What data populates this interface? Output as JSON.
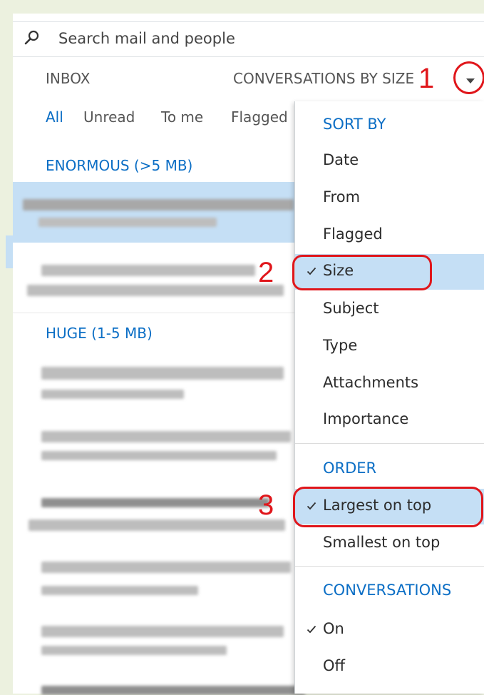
{
  "search": {
    "placeholder": "Search mail and people"
  },
  "header": {
    "inbox_title": "INBOX",
    "view_label": "CONVERSATIONS BY SIZE"
  },
  "filters": [
    "All",
    "Unread",
    "To me",
    "Flagged"
  ],
  "groups": [
    {
      "label": "ENORMOUS (>5 MB)"
    },
    {
      "label": "HUGE (1-5 MB)"
    }
  ],
  "menu": {
    "sort_heading": "SORT BY",
    "sort_items": [
      {
        "label": "Date",
        "checked": false
      },
      {
        "label": "From",
        "checked": false
      },
      {
        "label": "Flagged",
        "checked": false
      },
      {
        "label": "Size",
        "checked": true
      },
      {
        "label": "Subject",
        "checked": false
      },
      {
        "label": "Type",
        "checked": false
      },
      {
        "label": "Attachments",
        "checked": false
      },
      {
        "label": "Importance",
        "checked": false
      }
    ],
    "order_heading": "ORDER",
    "order_items": [
      {
        "label": "Largest on top",
        "checked": true
      },
      {
        "label": "Smallest on top",
        "checked": false
      }
    ],
    "conv_heading": "CONVERSATIONS",
    "conv_items": [
      {
        "label": "On",
        "checked": true
      },
      {
        "label": "Off",
        "checked": false
      }
    ]
  },
  "annotations": [
    "1",
    "2",
    "3"
  ],
  "colors": {
    "accent": "#0b6ec5",
    "highlight": "#c5dff5",
    "callout": "#e0161b",
    "frame": "#ecf1df"
  }
}
